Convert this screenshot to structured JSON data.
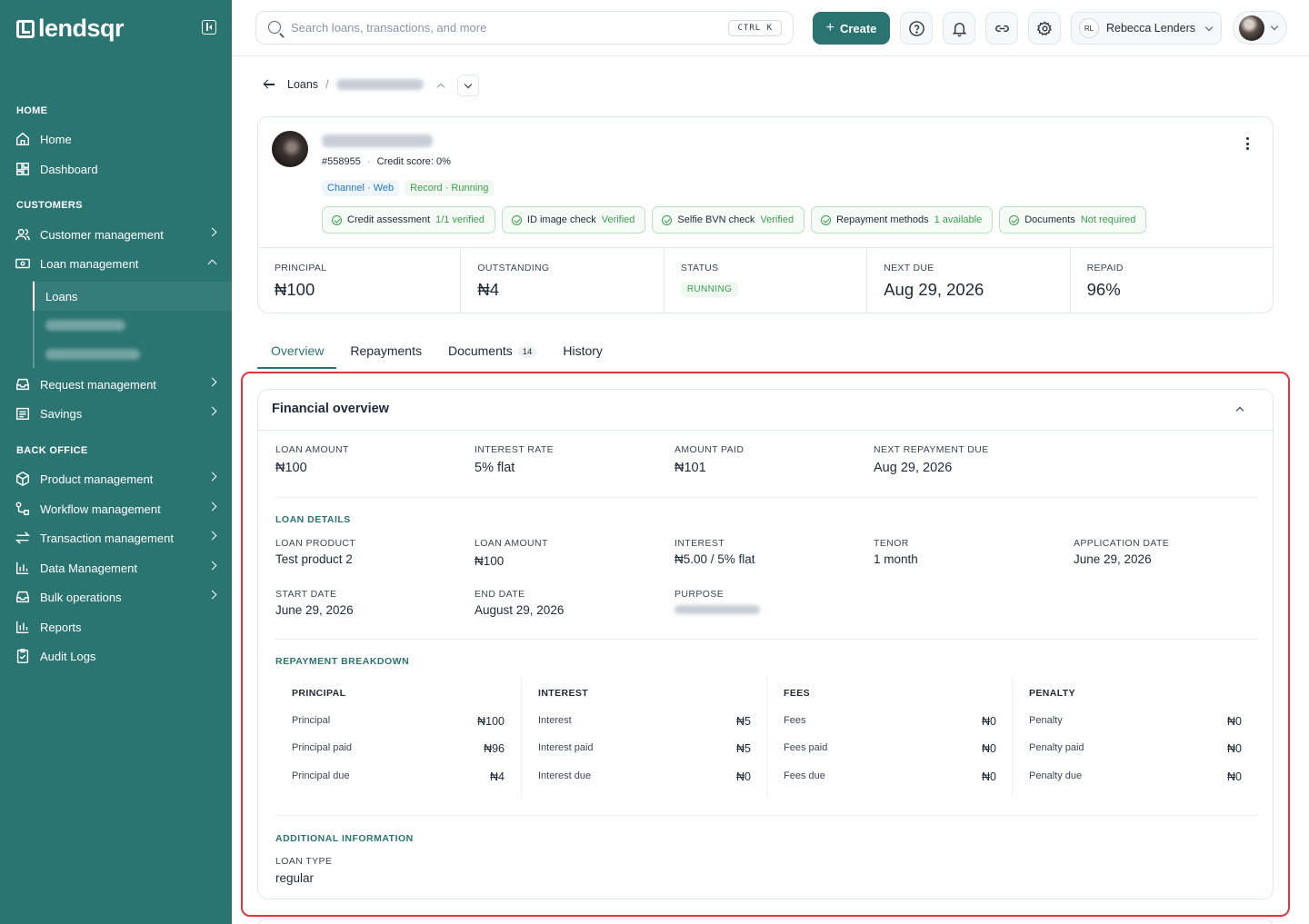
{
  "brand": {
    "name": "lendsqr"
  },
  "sidebar": {
    "sections": {
      "home": "HOME",
      "customers": "CUSTOMERS",
      "back_office": "BACK OFFICE"
    },
    "items": {
      "home": "Home",
      "dashboard": "Dashboard",
      "customer_management": "Customer management",
      "loan_management": "Loan management",
      "loans": "Loans",
      "request_management": "Request management",
      "savings": "Savings",
      "product_management": "Product management",
      "workflow_management": "Workflow management",
      "transaction_management": "Transaction management",
      "data_management": "Data Management",
      "bulk_operations": "Bulk operations",
      "reports": "Reports",
      "audit_logs": "Audit Logs"
    }
  },
  "topbar": {
    "search_placeholder": "Search loans, transactions, and more",
    "shortcut": "CTRL K",
    "create_label": "Create",
    "user_initials": "RL",
    "user_name": "Rebecca Lenders"
  },
  "breadcrumb": {
    "parent": "Loans",
    "separator": "/"
  },
  "loan": {
    "id": "#558955",
    "credit_score": "Credit score: 0%",
    "tags": {
      "channel": "Channel · Web",
      "record": "Record · Running"
    },
    "checks": [
      {
        "label": "Credit assessment",
        "value": "1/1 verified"
      },
      {
        "label": "ID image check",
        "value": "Verified"
      },
      {
        "label": "Selfie BVN check",
        "value": "Verified"
      },
      {
        "label": "Repayment methods",
        "value": "1 available"
      },
      {
        "label": "Documents",
        "value": "Not required"
      }
    ],
    "stats": {
      "principal": {
        "label": "PRINCIPAL",
        "value": "₦100"
      },
      "outstanding": {
        "label": "OUTSTANDING",
        "value": "₦4"
      },
      "status": {
        "label": "STATUS",
        "value": "RUNNING"
      },
      "next_due": {
        "label": "NEXT DUE",
        "value": "Aug 29, 2026"
      },
      "repaid": {
        "label": "REPAID",
        "value": "96%"
      }
    }
  },
  "tabs": {
    "overview": "Overview",
    "repayments": "Repayments",
    "documents": "Documents",
    "documents_count": "14",
    "history": "History"
  },
  "financial": {
    "title": "Financial overview",
    "summary": {
      "loan_amount": {
        "label": "LOAN AMOUNT",
        "value": "₦100"
      },
      "interest_rate": {
        "label": "INTEREST RATE",
        "value": "5% flat"
      },
      "amount_paid": {
        "label": "AMOUNT PAID",
        "value": "₦101"
      },
      "next_repayment": {
        "label": "NEXT REPAYMENT DUE",
        "value": "Aug 29, 2026"
      }
    },
    "loan_details": {
      "title": "LOAN DETAILS",
      "loan_product": {
        "label": "LOAN PRODUCT",
        "value": "Test product 2"
      },
      "loan_amount": {
        "label": "LOAN AMOUNT",
        "value": "₦100"
      },
      "interest": {
        "label": "INTEREST",
        "value": "₦5.00 / 5% flat"
      },
      "tenor": {
        "label": "TENOR",
        "value": "1 month"
      },
      "application_date": {
        "label": "APPLICATION DATE",
        "value": "June 29, 2026"
      },
      "start_date": {
        "label": "START DATE",
        "value": "June 29, 2026"
      },
      "end_date": {
        "label": "END DATE",
        "value": "August 29, 2026"
      },
      "purpose": {
        "label": "PURPOSE"
      }
    },
    "repayment_breakdown": {
      "title": "REPAYMENT BREAKDOWN",
      "principal": {
        "title": "PRINCIPAL",
        "rows": [
          [
            "Principal",
            "₦100"
          ],
          [
            "Principal paid",
            "₦96"
          ],
          [
            "Principal due",
            "₦4"
          ]
        ]
      },
      "interest": {
        "title": "INTEREST",
        "rows": [
          [
            "Interest",
            "₦5"
          ],
          [
            "Interest paid",
            "₦5"
          ],
          [
            "Interest due",
            "₦0"
          ]
        ]
      },
      "fees": {
        "title": "FEES",
        "rows": [
          [
            "Fees",
            "₦0"
          ],
          [
            "Fees paid",
            "₦0"
          ],
          [
            "Fees due",
            "₦0"
          ]
        ]
      },
      "penalty": {
        "title": "PENALTY",
        "rows": [
          [
            "Penalty",
            "₦0"
          ],
          [
            "Penalty paid",
            "₦0"
          ],
          [
            "Penalty due",
            "₦0"
          ]
        ]
      }
    },
    "additional": {
      "title": "ADDITIONAL INFORMATION",
      "loan_type": {
        "label": "LOAN TYPE",
        "value": "regular"
      }
    }
  },
  "colors": {
    "primary": "#2a7472",
    "success": "#3d9e4f",
    "highlight": "#e0363e"
  }
}
